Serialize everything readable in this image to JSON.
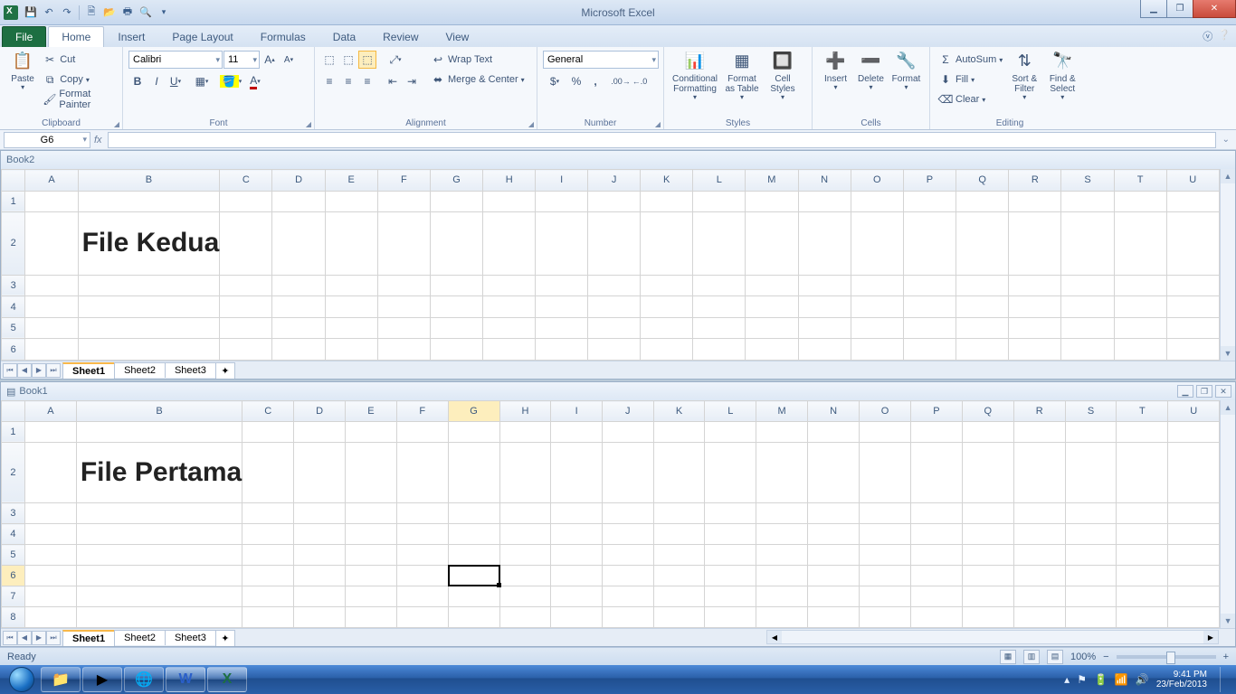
{
  "app_title": "Microsoft Excel",
  "qat": [
    "save",
    "undo",
    "redo",
    "new",
    "open",
    "quickprint",
    "preview"
  ],
  "tabs": {
    "file": "File",
    "items": [
      "Home",
      "Insert",
      "Page Layout",
      "Formulas",
      "Data",
      "Review",
      "View"
    ],
    "active": "Home"
  },
  "ribbon": {
    "clipboard": {
      "paste": "Paste",
      "cut": "Cut",
      "copy": "Copy",
      "fpaint": "Format Painter",
      "label": "Clipboard"
    },
    "font": {
      "name": "Calibri",
      "size": "11",
      "label": "Font"
    },
    "alignment": {
      "wrap": "Wrap Text",
      "merge": "Merge & Center",
      "label": "Alignment"
    },
    "number": {
      "fmt": "General",
      "label": "Number"
    },
    "styles": {
      "cond": "Conditional",
      "cond2": "Formatting",
      "fas": "Format",
      "fas2": "as Table",
      "cell": "Cell",
      "cell2": "Styles",
      "label": "Styles"
    },
    "cells": {
      "insert": "Insert",
      "delete": "Delete",
      "format": "Format",
      "label": "Cells"
    },
    "editing": {
      "sum": "AutoSum",
      "fill": "Fill",
      "clear": "Clear",
      "sort": "Sort &",
      "sort2": "Filter",
      "find": "Find &",
      "find2": "Select",
      "label": "Editing"
    }
  },
  "name_box": "G6",
  "formula_value": "",
  "columns": [
    "A",
    "B",
    "C",
    "D",
    "E",
    "F",
    "G",
    "H",
    "I",
    "J",
    "K",
    "L",
    "M",
    "N",
    "O",
    "P",
    "Q",
    "R",
    "S",
    "T",
    "U"
  ],
  "workbooks": {
    "top": {
      "title": "Book2",
      "bigtext": "File Kedua",
      "rows": [
        1,
        2,
        3,
        4,
        5,
        6
      ],
      "sheets": [
        "Sheet1",
        "Sheet2",
        "Sheet3"
      ],
      "active": "Sheet1"
    },
    "bottom": {
      "title": "Book1",
      "bigtext": "File Pertama",
      "rows": [
        1,
        2,
        3,
        4,
        5,
        6,
        7,
        8
      ],
      "sheets": [
        "Sheet1",
        "Sheet2",
        "Sheet3"
      ],
      "active": "Sheet1",
      "active_cell": "G6",
      "sel_col": "G",
      "sel_row": 6
    }
  },
  "status": {
    "ready": "Ready",
    "zoom": "100%"
  },
  "tray": {
    "time": "9:41 PM",
    "date": "23/Feb/2013"
  }
}
